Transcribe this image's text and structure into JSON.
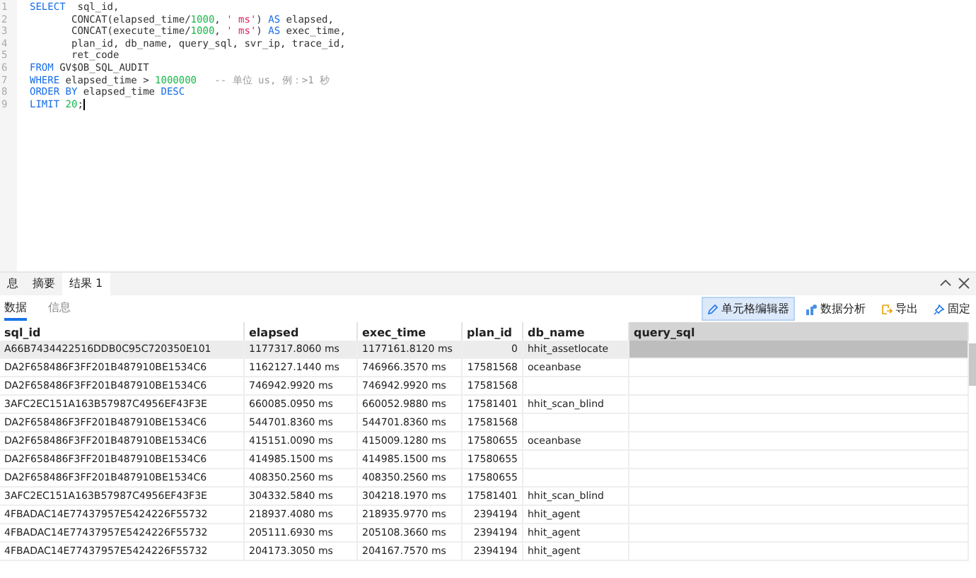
{
  "editor": {
    "lines": [
      [
        {
          "kind": "keyword",
          "text": "SELECT"
        },
        {
          "kind": "plain",
          "text": "  sql_id,"
        }
      ],
      [
        {
          "kind": "plain",
          "text": "       CONCAT(elapsed_time/"
        },
        {
          "kind": "number",
          "text": "1000"
        },
        {
          "kind": "plain",
          "text": ", "
        },
        {
          "kind": "string",
          "text": "' ms'"
        },
        {
          "kind": "plain",
          "text": ") "
        },
        {
          "kind": "keyword",
          "text": "AS"
        },
        {
          "kind": "plain",
          "text": " elapsed,"
        }
      ],
      [
        {
          "kind": "plain",
          "text": "       CONCAT(execute_time/"
        },
        {
          "kind": "number",
          "text": "1000"
        },
        {
          "kind": "plain",
          "text": ", "
        },
        {
          "kind": "string",
          "text": "' ms'"
        },
        {
          "kind": "plain",
          "text": ") "
        },
        {
          "kind": "keyword",
          "text": "AS"
        },
        {
          "kind": "plain",
          "text": " exec_time,"
        }
      ],
      [
        {
          "kind": "plain",
          "text": "       plan_id, db_name, query_sql, svr_ip, trace_id,"
        }
      ],
      [
        {
          "kind": "plain",
          "text": "       ret_code"
        }
      ],
      [
        {
          "kind": "keyword",
          "text": "FROM"
        },
        {
          "kind": "plain",
          "text": " GV$OB_SQL_AUDIT"
        }
      ],
      [
        {
          "kind": "keyword",
          "text": "WHERE"
        },
        {
          "kind": "plain",
          "text": " elapsed_time > "
        },
        {
          "kind": "number",
          "text": "1000000"
        },
        {
          "kind": "comment",
          "text": "   -- 单位 us, 例：>1 秒"
        }
      ],
      [
        {
          "kind": "keyword",
          "text": "ORDER BY"
        },
        {
          "kind": "plain",
          "text": " elapsed_time "
        },
        {
          "kind": "keyword",
          "text": "DESC"
        }
      ],
      [
        {
          "kind": "keyword",
          "text": "LIMIT"
        },
        {
          "kind": "number",
          "text": " 20"
        },
        {
          "kind": "plain",
          "text": ";"
        }
      ]
    ],
    "line_numbers": [
      "1",
      "2",
      "3",
      "4",
      "5",
      "6",
      "7",
      "8",
      "9"
    ]
  },
  "result_tabs": [
    {
      "label": "息",
      "selected": false
    },
    {
      "label": "摘要",
      "selected": false
    },
    {
      "label": "结果 1",
      "selected": true
    }
  ],
  "sub_tabs": [
    {
      "label": "数据",
      "selected": true
    },
    {
      "label": "信息",
      "selected": false
    }
  ],
  "toolbar": [
    {
      "kind": "cell-editor",
      "label": "单元格编辑器",
      "selected": true
    },
    {
      "kind": "analysis",
      "label": "数据分析",
      "selected": false
    },
    {
      "kind": "export",
      "label": "导出",
      "selected": false
    },
    {
      "kind": "pin",
      "label": "固定",
      "selected": false
    }
  ],
  "table": {
    "columns": [
      {
        "label": "sql_id",
        "selected": false
      },
      {
        "label": "elapsed",
        "selected": false
      },
      {
        "label": "exec_time",
        "selected": false
      },
      {
        "label": "plan_id",
        "selected": false
      },
      {
        "label": "db_name",
        "selected": false
      },
      {
        "label": "query_sql",
        "selected": true
      }
    ],
    "rows": [
      {
        "selected": true,
        "cells": [
          "A66B7434422516DDB0C95C720350E101",
          "1177317.8060 ms",
          "1177161.8120 ms",
          "0",
          "hhit_assetlocate"
        ]
      },
      {
        "selected": false,
        "cells": [
          "DA2F658486F3FF201B487910BE1534C6",
          "1162127.1440 ms",
          "746966.3570 ms",
          "17581568",
          "oceanbase"
        ]
      },
      {
        "selected": false,
        "cells": [
          "DA2F658486F3FF201B487910BE1534C6",
          "746942.9920 ms",
          "746942.9920 ms",
          "17581568"
        ]
      },
      {
        "selected": false,
        "cells": [
          "3AFC2EC151A163B57987C4956EF43F3E",
          "660085.0950 ms",
          "660052.9880 ms",
          "17581401",
          "hhit_scan_blind"
        ]
      },
      {
        "selected": false,
        "cells": [
          "DA2F658486F3FF201B487910BE1534C6",
          "544701.8360 ms",
          "544701.8360 ms",
          "17581568"
        ]
      },
      {
        "selected": false,
        "cells": [
          "DA2F658486F3FF201B487910BE1534C6",
          "415151.0090 ms",
          "415009.1280 ms",
          "17580655",
          "oceanbase"
        ]
      },
      {
        "selected": false,
        "cells": [
          "DA2F658486F3FF201B487910BE1534C6",
          "414985.1500 ms",
          "414985.1500 ms",
          "17580655"
        ]
      },
      {
        "selected": false,
        "cells": [
          "DA2F658486F3FF201B487910BE1534C6",
          "408350.2560 ms",
          "408350.2560 ms",
          "17580655"
        ]
      },
      {
        "selected": false,
        "cells": [
          "3AFC2EC151A163B57987C4956EF43F3E",
          "304332.5840 ms",
          "304218.1970 ms",
          "17581401",
          "hhit_scan_blind"
        ]
      },
      {
        "selected": false,
        "cells": [
          "4FBADAC14E77437957E5424226F55732",
          "218937.4080 ms",
          "218935.9770 ms",
          "2394194",
          "hhit_agent"
        ]
      },
      {
        "selected": false,
        "cells": [
          "4FBADAC14E77437957E5424226F55732",
          "205111.6930 ms",
          "205108.3660 ms",
          "2394194",
          "hhit_agent"
        ]
      },
      {
        "selected": false,
        "cells": [
          "4FBADAC14E77437957E5424226F55732",
          "204173.3050 ms",
          "204167.7570 ms",
          "2394194",
          "hhit_agent"
        ]
      }
    ]
  }
}
